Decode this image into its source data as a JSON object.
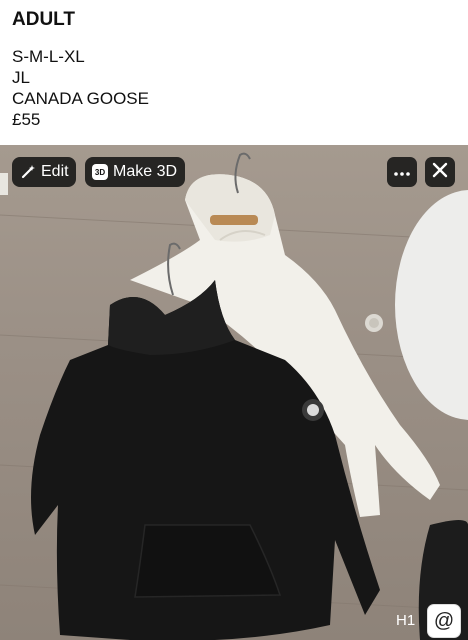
{
  "post": {
    "title": "ADULT",
    "lines": [
      "S-M-L-XL",
      "JL",
      "CANADA GOOSE",
      "£55"
    ]
  },
  "photo_overlay": {
    "edit_label": "Edit",
    "edit_icon": "magic-wand-icon",
    "make3d_label": "Make 3D",
    "make3d_badge": "3D",
    "more_icon": "more-dots-icon",
    "close_icon": "close-icon"
  },
  "footer": {
    "h1_label": "H1",
    "at_symbol": "@"
  },
  "colors": {
    "floor": "#9b9086",
    "black_hoodie": "#161616",
    "white_hoodie": "#f2f0ea",
    "overlay_button": "#141414"
  }
}
